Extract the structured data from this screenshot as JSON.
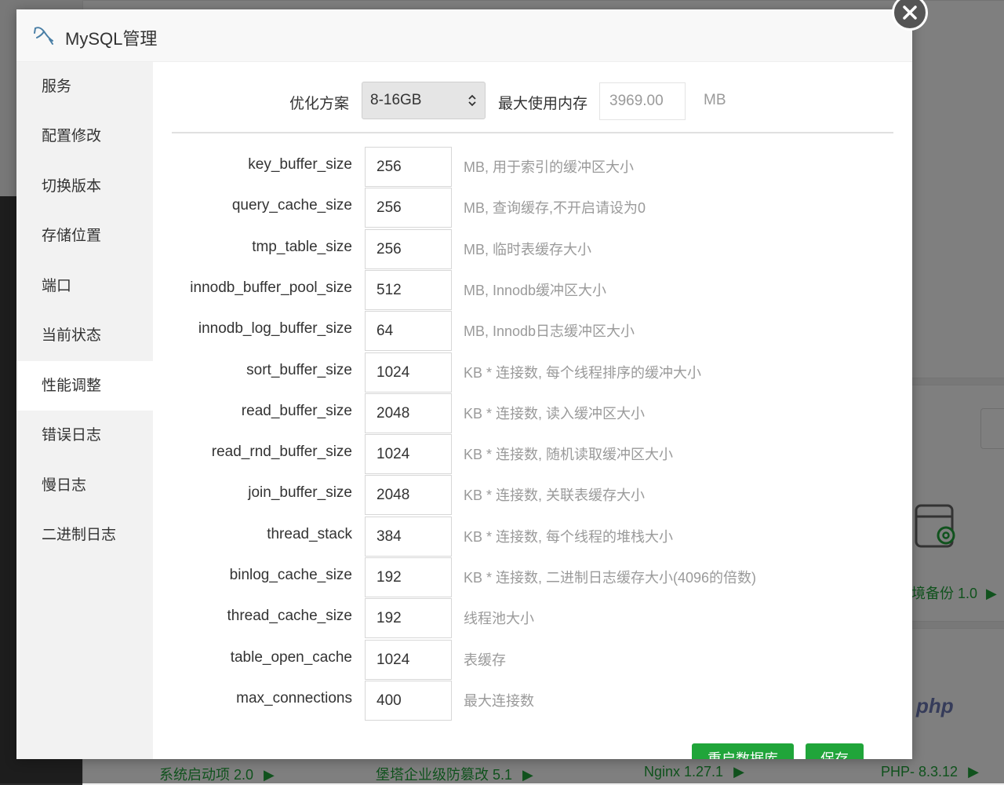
{
  "background": {
    "bottom_items": [
      {
        "label": "系统启动项 2.0",
        "arrow": "▶"
      },
      {
        "label": "堡塔企业级防篡改 5.1",
        "arrow": "▶"
      },
      {
        "label": "Nginx 1.27.1",
        "arrow": "▶"
      },
      {
        "label": "PHP- 8.3.12",
        "arrow": "▶"
      }
    ],
    "right_item": {
      "label": "境备份 1.0",
      "arrow": "▶"
    },
    "php_logo": "php"
  },
  "dialog": {
    "title": "MySQL管理",
    "logo_icon": "dolphin-icon",
    "close_icon": "close-icon"
  },
  "sidebar": {
    "items": [
      {
        "label": "服务"
      },
      {
        "label": "配置修改"
      },
      {
        "label": "切换版本"
      },
      {
        "label": "存储位置"
      },
      {
        "label": "端口"
      },
      {
        "label": "当前状态"
      },
      {
        "label": "性能调整",
        "active": true
      },
      {
        "label": "错误日志"
      },
      {
        "label": "慢日志"
      },
      {
        "label": "二进制日志"
      }
    ]
  },
  "optimization": {
    "scheme_label": "优化方案",
    "scheme_value": "8-16GB",
    "max_mem_label": "最大使用内存",
    "max_mem_value": "3969.00",
    "max_mem_unit": "MB"
  },
  "params": [
    {
      "name": "key_buffer_size",
      "value": "256",
      "desc": "MB, 用于索引的缓冲区大小"
    },
    {
      "name": "query_cache_size",
      "value": "256",
      "desc": "MB, 查询缓存,不开启请设为0"
    },
    {
      "name": "tmp_table_size",
      "value": "256",
      "desc": "MB, 临时表缓存大小"
    },
    {
      "name": "innodb_buffer_pool_size",
      "value": "512",
      "desc": "MB, Innodb缓冲区大小"
    },
    {
      "name": "innodb_log_buffer_size",
      "value": "64",
      "desc": "MB, Innodb日志缓冲区大小"
    },
    {
      "name": "sort_buffer_size",
      "value": "1024",
      "desc": "KB * 连接数, 每个线程排序的缓冲大小"
    },
    {
      "name": "read_buffer_size",
      "value": "2048",
      "desc": "KB * 连接数, 读入缓冲区大小"
    },
    {
      "name": "read_rnd_buffer_size",
      "value": "1024",
      "desc": "KB * 连接数, 随机读取缓冲区大小"
    },
    {
      "name": "join_buffer_size",
      "value": "2048",
      "desc": "KB * 连接数, 关联表缓存大小"
    },
    {
      "name": "thread_stack",
      "value": "384",
      "desc": "KB * 连接数, 每个线程的堆栈大小"
    },
    {
      "name": "binlog_cache_size",
      "value": "192",
      "desc": "KB * 连接数, 二进制日志缓存大小(4096的倍数)"
    },
    {
      "name": "thread_cache_size",
      "value": "192",
      "desc": "线程池大小"
    },
    {
      "name": "table_open_cache",
      "value": "1024",
      "desc": "表缓存"
    },
    {
      "name": "max_connections",
      "value": "400",
      "desc": "最大连接数"
    }
  ],
  "buttons": {
    "restart_label": "重启数据库",
    "save_label": "保存"
  },
  "colors": {
    "accent_green": "#20a53a"
  }
}
